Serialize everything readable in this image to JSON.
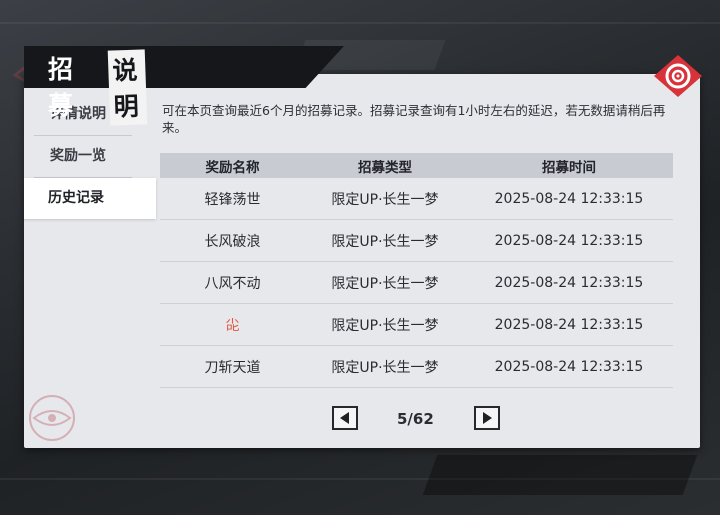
{
  "header": {
    "title_part1": "招募",
    "title_part2": "说明"
  },
  "sidebar": {
    "items": [
      {
        "label": "详情说明"
      },
      {
        "label": "奖励一览"
      },
      {
        "label": "历史记录"
      }
    ]
  },
  "description": "可在本页查询最近6个月的招募记录。招募记录查询有1小时左右的延迟，若无数据请稍后再来。",
  "table": {
    "headers": [
      "奖励名称",
      "招募类型",
      "招募时间"
    ],
    "rows": [
      {
        "name": "轻锋荡世",
        "type": "限定UP·长生一梦",
        "time": "2025-08-24 12:33:15",
        "highlight": false
      },
      {
        "name": "长风破浪",
        "type": "限定UP·长生一梦",
        "time": "2025-08-24 12:33:15",
        "highlight": false
      },
      {
        "name": "八风不动",
        "type": "限定UP·长生一梦",
        "time": "2025-08-24 12:33:15",
        "highlight": false
      },
      {
        "name": "㕾",
        "type": "限定UP·长生一梦",
        "time": "2025-08-24 12:33:15",
        "highlight": true
      },
      {
        "name": "刀斩天道",
        "type": "限定UP·长生一梦",
        "time": "2025-08-24 12:33:15",
        "highlight": false
      }
    ]
  },
  "pagination": {
    "current": 5,
    "total": 62,
    "text": "5/62"
  },
  "colors": {
    "accent_red": "#e5553f",
    "panel_bg": "#e7e8ec",
    "header_bg": "#c9cbd3",
    "close_red": "#d8333a"
  },
  "icons": {
    "close": "close-target-icon",
    "prev": "arrow-left-icon",
    "next": "arrow-right-icon"
  }
}
